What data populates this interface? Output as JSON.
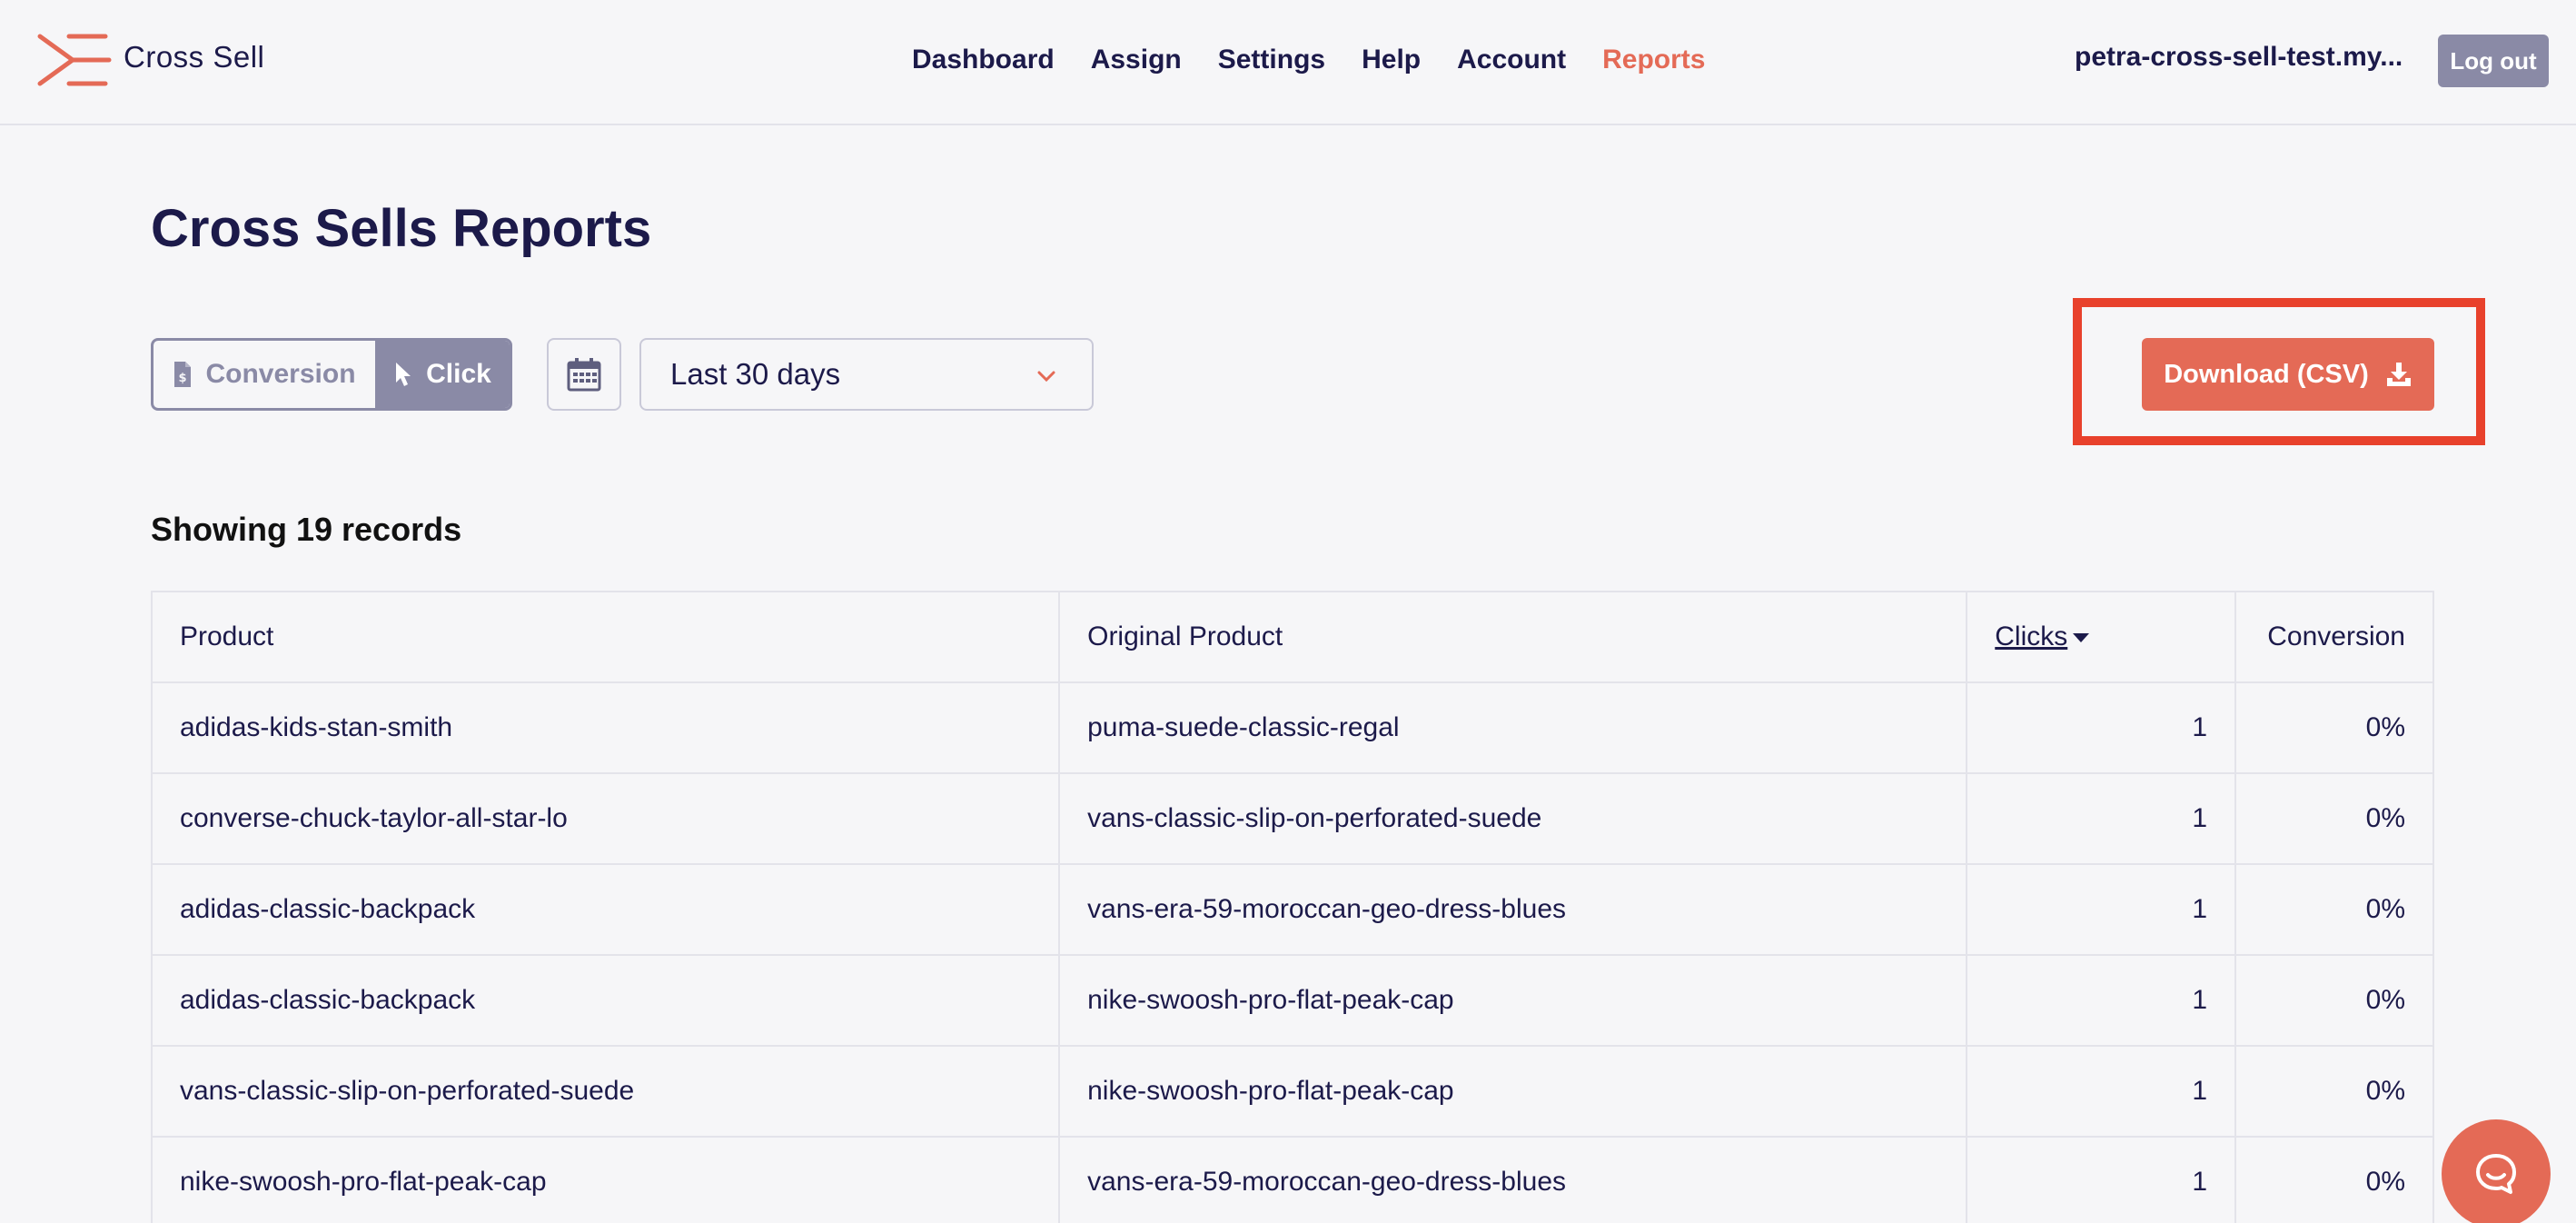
{
  "app": {
    "name": "Cross Sell"
  },
  "nav": [
    {
      "label": "Dashboard"
    },
    {
      "label": "Assign"
    },
    {
      "label": "Settings"
    },
    {
      "label": "Help"
    },
    {
      "label": "Account"
    },
    {
      "label": "Reports",
      "active": true
    }
  ],
  "header": {
    "shop_name": "petra-cross-sell-test.my...",
    "logout_label": "Log out"
  },
  "page": {
    "title": "Cross Sells Reports"
  },
  "controls": {
    "toggle": {
      "conversion_label": "Conversion",
      "click_label": "Click",
      "selected": "Click"
    },
    "date_range": {
      "selected": "Last 30 days"
    },
    "download_label": "Download (CSV)"
  },
  "records_text": "Showing 19 records",
  "table": {
    "headers": {
      "product": "Product",
      "original": "Original Product",
      "clicks": "Clicks",
      "conversion": "Conversion"
    },
    "rows": [
      {
        "product": "adidas-kids-stan-smith",
        "original": "puma-suede-classic-regal",
        "clicks": "1",
        "conversion": "0%"
      },
      {
        "product": "converse-chuck-taylor-all-star-lo",
        "original": "vans-classic-slip-on-perforated-suede",
        "clicks": "1",
        "conversion": "0%"
      },
      {
        "product": "adidas-classic-backpack",
        "original": "vans-era-59-moroccan-geo-dress-blues",
        "clicks": "1",
        "conversion": "0%"
      },
      {
        "product": "adidas-classic-backpack",
        "original": "nike-swoosh-pro-flat-peak-cap",
        "clicks": "1",
        "conversion": "0%"
      },
      {
        "product": "vans-classic-slip-on-perforated-suede",
        "original": "nike-swoosh-pro-flat-peak-cap",
        "clicks": "1",
        "conversion": "0%"
      },
      {
        "product": "nike-swoosh-pro-flat-peak-cap",
        "original": "vans-era-59-moroccan-geo-dress-blues",
        "clicks": "1",
        "conversion": "0%"
      }
    ]
  },
  "colors": {
    "accent": "#e46a56",
    "primary_text": "#1c1a4a",
    "muted": "#8a8aa6",
    "highlight": "#e8412c"
  },
  "icons": [
    "cross-sell-logo-icon",
    "dollar-document-icon",
    "cursor-pointer-icon",
    "calendar-icon",
    "chevron-down-icon",
    "download-icon",
    "chat-icon"
  ]
}
